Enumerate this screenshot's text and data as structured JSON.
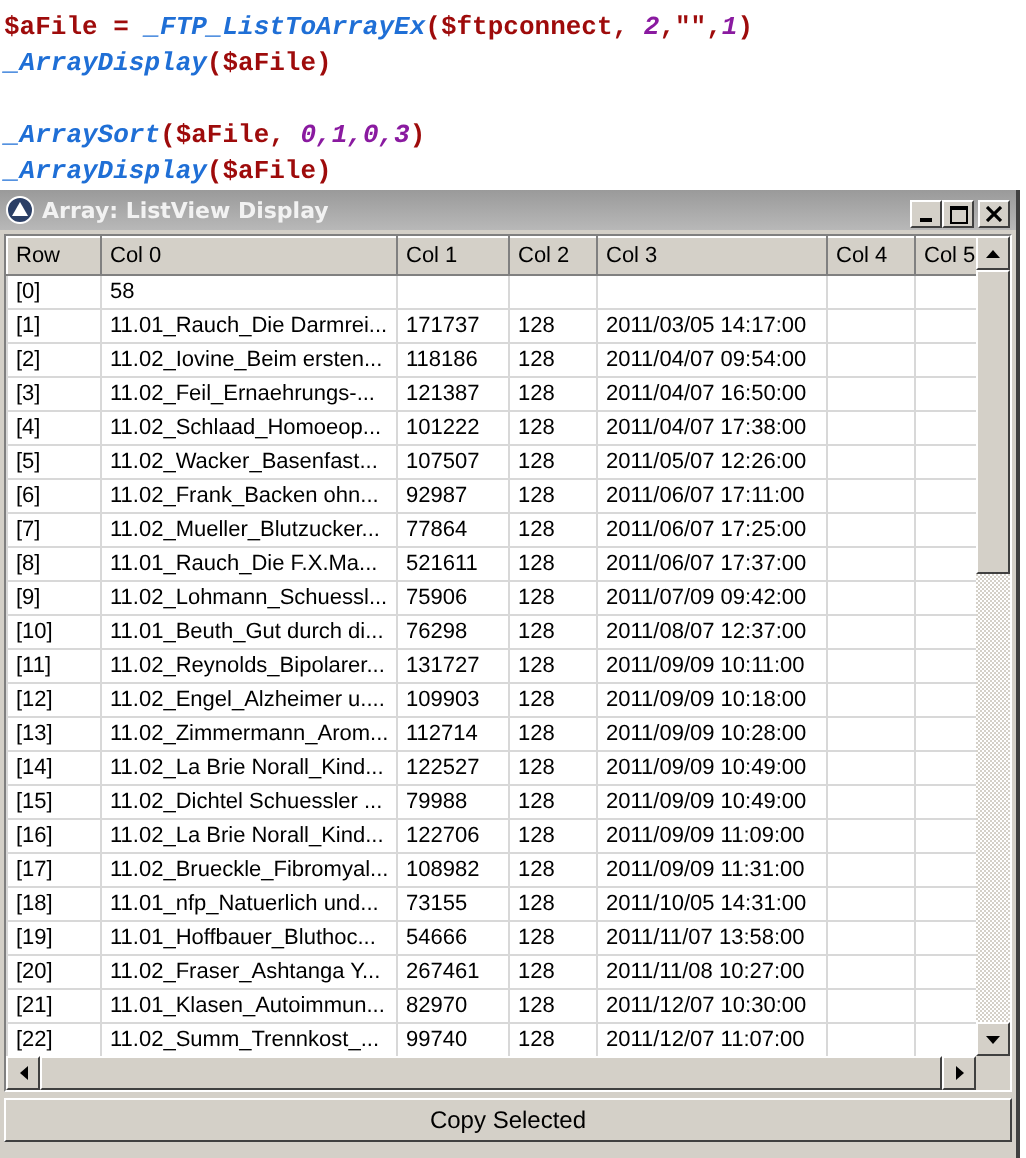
{
  "code": {
    "lines": [
      {
        "kind": "code",
        "tokens": [
          {
            "kind": "text",
            "text": "$aFile = "
          },
          {
            "kind": "func",
            "text": "_FTP_ListToArrayEx"
          },
          {
            "kind": "text",
            "text": "($ftpconnect, "
          },
          {
            "kind": "num",
            "text": "2"
          },
          {
            "kind": "text",
            "text": ",\"\","
          },
          {
            "kind": "num",
            "text": "1"
          },
          {
            "kind": "text",
            "text": ")"
          }
        ]
      },
      {
        "kind": "code",
        "tokens": [
          {
            "kind": "func",
            "text": "_ArrayDisplay"
          },
          {
            "kind": "text",
            "text": "($aFile)"
          }
        ]
      },
      {
        "kind": "blank"
      },
      {
        "kind": "code",
        "tokens": [
          {
            "kind": "func",
            "text": "_ArraySort"
          },
          {
            "kind": "text",
            "text": "($aFile, "
          },
          {
            "kind": "num",
            "text": "0,1,0,3"
          },
          {
            "kind": "text",
            "text": ")"
          }
        ]
      },
      {
        "kind": "code",
        "tokens": [
          {
            "kind": "func",
            "text": "_ArrayDisplay"
          },
          {
            "kind": "text",
            "text": "($aFile)"
          }
        ]
      }
    ]
  },
  "window": {
    "title": "Array: ListView Display"
  },
  "table": {
    "columns": [
      "Row",
      "Col 0",
      "Col 1",
      "Col 2",
      "Col 3",
      "Col 4",
      "Col 5"
    ],
    "rows": [
      [
        "[0]",
        "58",
        "",
        "",
        "",
        "",
        ""
      ],
      [
        "[1]",
        "11.01_Rauch_Die Darmrei...",
        "171737",
        "128",
        "2011/03/05 14:17:00",
        "",
        ""
      ],
      [
        "[2]",
        "11.02_Iovine_Beim ersten...",
        "118186",
        "128",
        "2011/04/07 09:54:00",
        "",
        ""
      ],
      [
        "[3]",
        "11.02_Feil_Ernaehrungs-...",
        "121387",
        "128",
        "2011/04/07 16:50:00",
        "",
        ""
      ],
      [
        "[4]",
        "11.02_Schlaad_Homoeop...",
        "101222",
        "128",
        "2011/04/07 17:38:00",
        "",
        ""
      ],
      [
        "[5]",
        "11.02_Wacker_Basenfast...",
        "107507",
        "128",
        "2011/05/07 12:26:00",
        "",
        ""
      ],
      [
        "[6]",
        "11.02_Frank_Backen ohn...",
        "92987",
        "128",
        "2011/06/07 17:11:00",
        "",
        ""
      ],
      [
        "[7]",
        "11.02_Mueller_Blutzucker...",
        "77864",
        "128",
        "2011/06/07 17:25:00",
        "",
        ""
      ],
      [
        "[8]",
        "11.01_Rauch_Die F.X.Ma...",
        "521611",
        "128",
        "2011/06/07 17:37:00",
        "",
        ""
      ],
      [
        "[9]",
        "11.02_Lohmann_Schuessl...",
        "75906",
        "128",
        "2011/07/09 09:42:00",
        "",
        ""
      ],
      [
        "[10]",
        "11.01_Beuth_Gut durch di...",
        "76298",
        "128",
        "2011/08/07 12:37:00",
        "",
        ""
      ],
      [
        "[11]",
        "11.02_Reynolds_Bipolarer...",
        "131727",
        "128",
        "2011/09/09 10:11:00",
        "",
        ""
      ],
      [
        "[12]",
        "11.02_Engel_Alzheimer u....",
        "109903",
        "128",
        "2011/09/09 10:18:00",
        "",
        ""
      ],
      [
        "[13]",
        "11.02_Zimmermann_Arom...",
        "112714",
        "128",
        "2011/09/09 10:28:00",
        "",
        ""
      ],
      [
        "[14]",
        "11.02_La Brie Norall_Kind...",
        "122527",
        "128",
        "2011/09/09 10:49:00",
        "",
        ""
      ],
      [
        "[15]",
        "11.02_Dichtel Schuessler ...",
        "79988",
        "128",
        "2011/09/09 10:49:00",
        "",
        ""
      ],
      [
        "[16]",
        "11.02_La Brie Norall_Kind...",
        "122706",
        "128",
        "2011/09/09 11:09:00",
        "",
        ""
      ],
      [
        "[17]",
        "11.02_Brueckle_Fibromyal...",
        "108982",
        "128",
        "2011/09/09 11:31:00",
        "",
        ""
      ],
      [
        "[18]",
        "11.01_nfp_Natuerlich und...",
        "73155",
        "128",
        "2011/10/05 14:31:00",
        "",
        ""
      ],
      [
        "[19]",
        "11.01_Hoffbauer_Bluthoc...",
        "54666",
        "128",
        "2011/11/07 13:58:00",
        "",
        ""
      ],
      [
        "[20]",
        "11.02_Fraser_Ashtanga Y...",
        "267461",
        "128",
        "2011/11/08 10:27:00",
        "",
        ""
      ],
      [
        "[21]",
        "11.01_Klasen_Autoimmun...",
        "82970",
        "128",
        "2011/12/07 10:30:00",
        "",
        ""
      ],
      [
        "[22]",
        "11.02_Summ_Trennkost_...",
        "99740",
        "128",
        "2011/12/07 11:07:00",
        "",
        ""
      ]
    ]
  },
  "button": "Copy Selected"
}
